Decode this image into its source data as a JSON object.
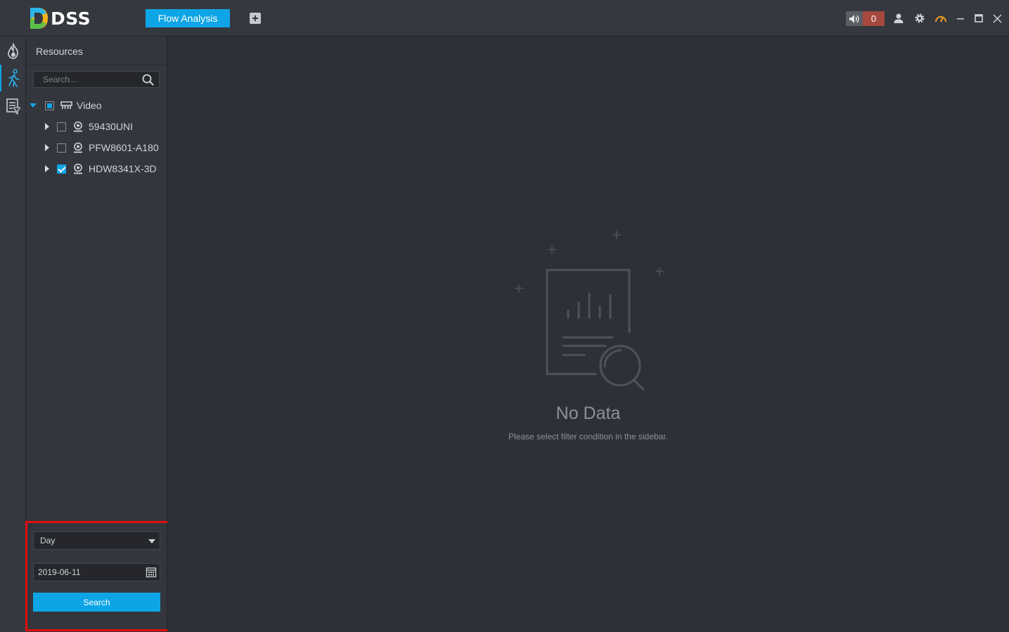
{
  "app": {
    "name": "DSS"
  },
  "tabs": [
    {
      "label": "Flow Analysis",
      "active": true
    }
  ],
  "topbar": {
    "alarm_count": "0"
  },
  "sidebar": {
    "title": "Resources",
    "search_placeholder": "Search...",
    "tree": {
      "root": {
        "label": "Video",
        "expanded": true,
        "check_state": "partial"
      },
      "children": [
        {
          "label": "59430UNI",
          "checked": false
        },
        {
          "label": "PFW8601-A180",
          "checked": false
        },
        {
          "label": "HDW8341X-3D",
          "checked": true
        }
      ]
    },
    "filter": {
      "period": {
        "selected": "Day"
      },
      "date": "2019-06-11",
      "search_label": "Search"
    }
  },
  "main": {
    "empty_title": "No Data",
    "empty_subtitle": "Please select filter condition in the sidebar."
  },
  "colors": {
    "accent": "#0ea5e6",
    "alarm": "#a6493f",
    "highlight_border": "#e10e0e"
  }
}
